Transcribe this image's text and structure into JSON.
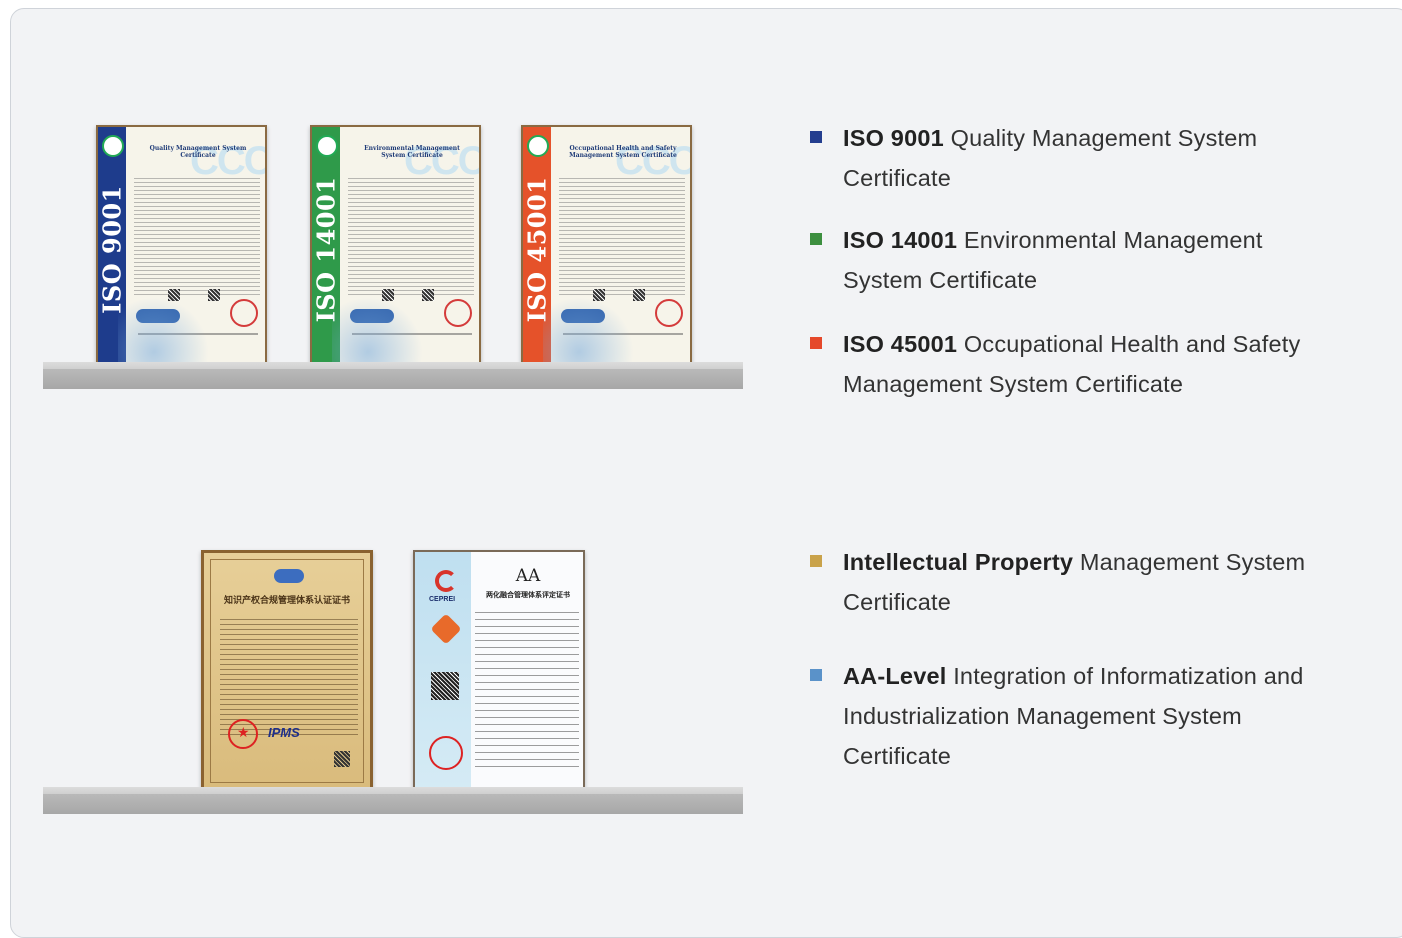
{
  "certificates_top": [
    {
      "band_label": "ISO 9001",
      "band_color": "#1e3c8c",
      "card_title": "Quality Management System Certificate"
    },
    {
      "band_label": "ISO 14001",
      "band_color": "#2f9a4a",
      "card_title": "Environmental Management System Certificate"
    },
    {
      "band_label": "ISO 45001",
      "band_color": "#e5522a",
      "card_title": "Occupational Health and Safety Management System Certificate"
    }
  ],
  "certificates_bottom": {
    "ipm": {
      "title": "知识产权合规管理体系认证证书",
      "logo_text": "IPMS"
    },
    "aa": {
      "title": "AA",
      "subtitle": "两化融合管理体系评定证书",
      "logo_text": "CEPREI"
    }
  },
  "list_top": [
    {
      "bold": "ISO 9001",
      "rest": " Quality Management System Certificate",
      "bullet_color": "#243e8f"
    },
    {
      "bold": "ISO 14001",
      "rest": " Environmental Management System Certificate",
      "bullet_color": "#3d8f3f"
    },
    {
      "bold": "ISO 45001",
      "rest": " Occupational Health and Safety Management System Certificate",
      "bullet_color": "#e5482a"
    }
  ],
  "list_bottom": [
    {
      "bold": "Intellectual Property",
      "rest": " Management System Certificate",
      "bullet_color": "#c9a24a"
    },
    {
      "bold": "AA-Level",
      "rest": " Integration of Informatization and Industrialization Management System Certificate",
      "bullet_color": "#5a92c9"
    }
  ]
}
